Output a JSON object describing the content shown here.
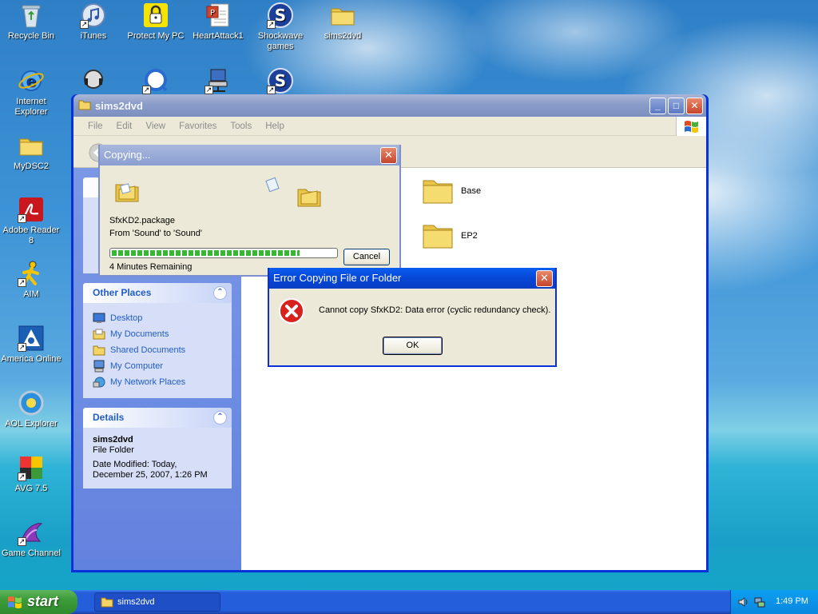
{
  "desktop": {
    "icons": [
      {
        "label": "Recycle Bin"
      },
      {
        "label": "iTunes"
      },
      {
        "label": "Protect My PC"
      },
      {
        "label": "HeartAttack1"
      },
      {
        "label": "Shockwave games"
      },
      {
        "label": "sims2dvd"
      },
      {
        "label": "Internet Explorer"
      },
      {
        "label": "MyDSC2"
      },
      {
        "label": "Adobe Reader 8"
      },
      {
        "label": "AIM"
      },
      {
        "label": "America Online"
      },
      {
        "label": "AOL Explorer"
      },
      {
        "label": "AVG 7.5"
      },
      {
        "label": "Game Channel"
      }
    ]
  },
  "explorer": {
    "title": "sims2dvd",
    "menu": [
      "File",
      "Edit",
      "View",
      "Favorites",
      "Tools",
      "Help"
    ],
    "other_places": {
      "heading": "Other Places",
      "items": [
        "Desktop",
        "My Documents",
        "Shared Documents",
        "My Computer",
        "My Network Places"
      ]
    },
    "details": {
      "heading": "Details",
      "name": "sims2dvd",
      "type": "File Folder",
      "modified_line1": "Date Modified: Today,",
      "modified_line2": "December 25, 2007, 1:26 PM"
    },
    "folders": [
      "Base",
      "EP2"
    ]
  },
  "copy_dialog": {
    "title": "Copying...",
    "filename": "SfxKD2.package",
    "from_to": "From 'Sound' to 'Sound'",
    "progress": 0.84,
    "remaining": "4 Minutes Remaining",
    "cancel_label": "Cancel"
  },
  "error_dialog": {
    "title": "Error Copying File or Folder",
    "message": "Cannot copy SfxKD2: Data error (cyclic redundancy check).",
    "ok_label": "OK"
  },
  "taskbar": {
    "start_label": "start",
    "task_label": "sims2dvd",
    "clock": "1:49 PM"
  }
}
